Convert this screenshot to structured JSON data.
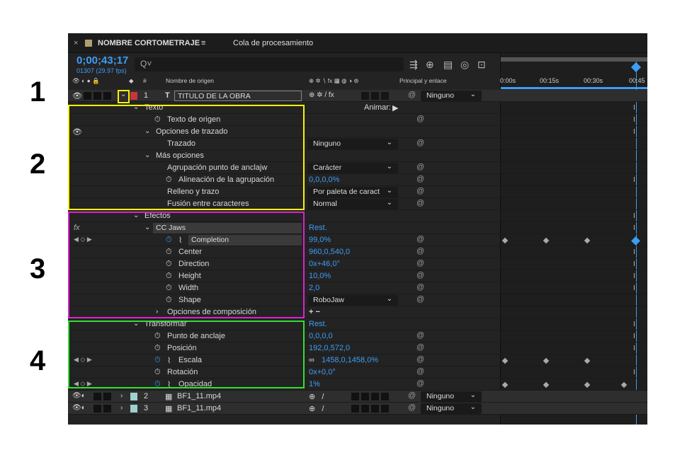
{
  "annotations": [
    "1",
    "2",
    "3",
    "4"
  ],
  "tabs": {
    "close": "×",
    "comp_name": "NOMBRE CORTOMETRAJE",
    "menu": "≡",
    "queue": "Cola de procesamiento"
  },
  "time": {
    "timecode": "0;00;43;17",
    "frames": "01307 (29.97 fps)"
  },
  "search": {
    "icon": "Q˅"
  },
  "columns": {
    "hash": "#",
    "layer_name": "Nombre de origen",
    "parent": "Principal y enlace"
  },
  "ruler": [
    "0:00s",
    "00:15s",
    "00:30s",
    "00:45"
  ],
  "layer1": {
    "num": "1",
    "type": "T",
    "name": "TITULO DE LA OBRA",
    "parent": "Ninguno"
  },
  "props": {
    "texto": "Texto",
    "animar": "Animar:",
    "texto_origen": "Texto de origen",
    "opciones_trazado": "Opciones de trazado",
    "trazado": "Trazado",
    "trazado_val": "Ninguno",
    "mas_opciones": "Más opciones",
    "agrupacion": "Agrupación punto de anclajw",
    "agrupacion_val": "Carácter",
    "alineacion": "Alineación de la agrupación",
    "alineacion_val": "0,0,0,0%",
    "relleno": "Relleno y trazo",
    "relleno_val": "Por paleta de caract",
    "fusion": "Fusión entre caracteres",
    "fusion_val": "Normal",
    "efectos": "Efectos",
    "fx": "fx",
    "ccjaws": "CC Jaws",
    "rest": "Rest.",
    "completion": "Completion",
    "completion_val": "99,0%",
    "center": "Center",
    "center_val": "960,0,540,0",
    "direction": "Direction",
    "direction_val": "0x+46,0°",
    "height": "Height",
    "height_val": "10,0%",
    "width": "Width",
    "width_val": "2,0",
    "shape": "Shape",
    "shape_val": "RoboJaw",
    "comp_opts": "Opciones de composición",
    "plusminus": "+ −",
    "transformar": "Transformar",
    "rest2": "Rest.",
    "anclaje": "Punto de anclaje",
    "anclaje_val": "0,0,0,0",
    "posicion": "Posición",
    "posicion_val": "192,0,572,0",
    "escala": "Escala",
    "escala_val": "1458,0,1458,0%",
    "rotacion": "Rotación",
    "rotacion_val": "0x+0,0°",
    "opacidad": "Opacidad",
    "opacidad_val": "1%"
  },
  "layer2": {
    "num": "2",
    "name": "BF1_11.mp4",
    "parent": "Ninguno"
  },
  "layer3": {
    "num": "3",
    "name": "BF1_11.mp4",
    "parent": "Ninguno"
  },
  "colors": {
    "accent": "#3d9df5",
    "yellow": "#f5f500",
    "magenta": "#e020d0",
    "green": "#30e030",
    "label_red": "#c8363b",
    "clip_red": "#a33a3f",
    "clip_teal": "#5a7a7a"
  }
}
